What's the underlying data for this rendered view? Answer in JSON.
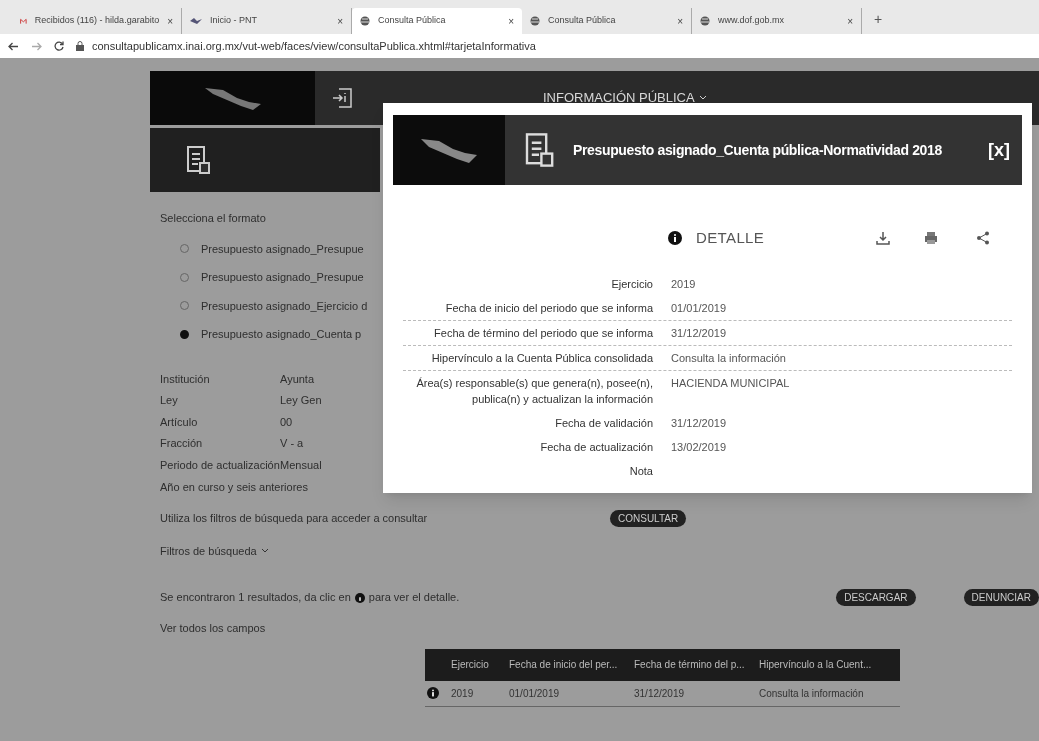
{
  "browser": {
    "tabs": [
      {
        "label": "Recibidos (116) - hilda.garabito",
        "kind": "mail",
        "close": "×",
        "selected": false
      },
      {
        "label": "Inicio - PNT",
        "kind": "site",
        "close": "×",
        "selected": false
      },
      {
        "label": "Consulta Pública",
        "kind": "web",
        "close": "×",
        "selected": true
      },
      {
        "label": "Consulta Pública",
        "kind": "web",
        "close": "×",
        "selected": false
      },
      {
        "label": "www.dof.gob.mx",
        "kind": "web",
        "close": "×",
        "selected": false
      }
    ],
    "new_tab": "+",
    "address": "consultapublicamx.inai.org.mx/vut-web/faces/view/consultaPublica.xhtml#tarjetaInformativa"
  },
  "page": {
    "nav_menu": "INFORMACIÓN PÚBLICA",
    "format_prompt": "Selecciona el formato",
    "formats": [
      {
        "label": "Presupuesto asignado_Presupue",
        "selected": false
      },
      {
        "label": "Presupuesto asignado_Presupue",
        "selected": false
      },
      {
        "label": "Presupuesto asignado_Ejercicio d",
        "selected": false
      },
      {
        "label": "Presupuesto asignado_Cuenta p",
        "selected": true
      }
    ],
    "fields": [
      {
        "label": "Institución",
        "value": "Ayunta"
      },
      {
        "label": "Ley",
        "value": "Ley Gen"
      },
      {
        "label": "Artículo",
        "value": "00"
      },
      {
        "label": "Fracción",
        "value": "V - a"
      },
      {
        "label": "Periodo de actualización",
        "value": "Mensual"
      }
    ],
    "period_note": "Año en curso y seis anteriores",
    "filter_hint": "Utiliza los filtros de búsqueda para acceder a consultar",
    "consult_button": "CONSULTAR",
    "filters_toggle": "Filtros de búsqueda",
    "results_text": "Se encontraron 1 resultados, da clic en",
    "results_text_end": "para ver el detalle.",
    "download_button": "DESCARGAR",
    "report_button": "DENUNCIAR",
    "all_fields_link": "Ver todos los campos",
    "table": {
      "columns": [
        "Ejercicio",
        "Fecha de inicio del per...",
        "Fecha de término del p...",
        "Hipervínculo a la Cuent..."
      ],
      "rows": [
        [
          "2019",
          "01/01/2019",
          "31/12/2019",
          "Consulta la información"
        ]
      ]
    }
  },
  "modal": {
    "title": "Presupuesto asignado_Cuenta pública-Normatividad 2018",
    "close": "[x]",
    "section": "DETALLE",
    "details": [
      {
        "label": "Ejercicio",
        "value": "2019",
        "divider": false
      },
      {
        "label": "Fecha de inicio del periodo que se informa",
        "value": "01/01/2019",
        "divider": true
      },
      {
        "label": "Fecha de término del periodo que se informa",
        "value": "31/12/2019",
        "divider": true
      },
      {
        "label": "Hipervínculo a la Cuenta Pública consolidada",
        "value": "Consulta la información",
        "divider": true
      },
      {
        "label": "Área(s) responsable(s) que genera(n), posee(n), publica(n) y actualizan la información",
        "value": "HACIENDA MUNICIPAL",
        "divider": false
      },
      {
        "label": "Fecha de validación",
        "value": "31/12/2019",
        "divider": false
      },
      {
        "label": "Fecha de actualización",
        "value": "13/02/2019",
        "divider": false
      },
      {
        "label": "Nota",
        "divider": false
      }
    ]
  }
}
